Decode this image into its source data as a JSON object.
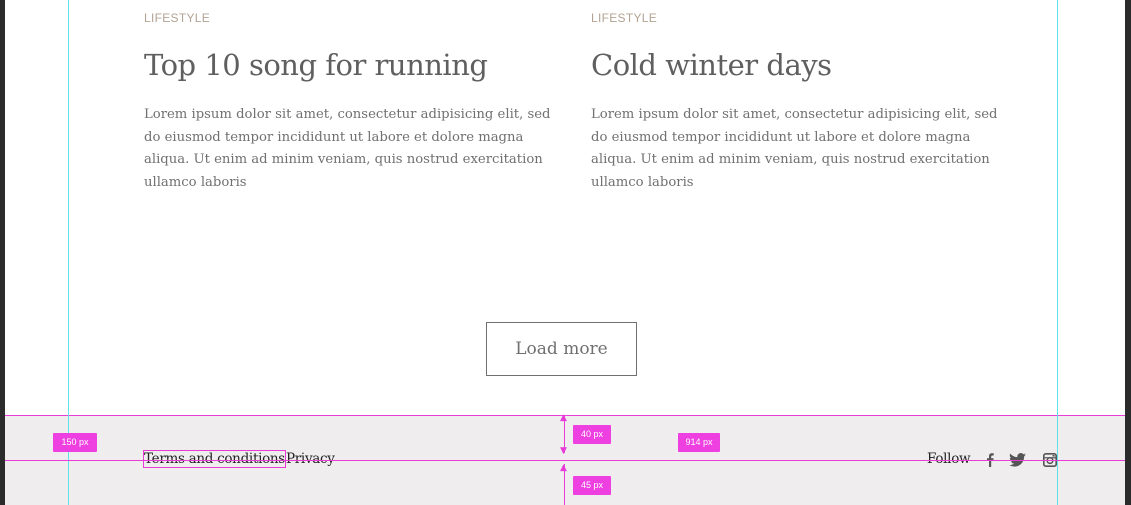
{
  "articles": [
    {
      "category": "LIFESTYLE",
      "title": "Top 10 song for running",
      "excerpt": "Lorem ipsum dolor sit amet, consectetur adipisicing elit, sed do eiusmod tempor incididunt ut labore et dolore magna aliqua. Ut enim ad minim veniam, quis nostrud exercitation ullamco laboris"
    },
    {
      "category": "LIFESTYLE",
      "title": "Cold winter days",
      "excerpt": "Lorem ipsum dolor sit amet, consectetur adipisicing elit, sed do eiusmod tempor incididunt ut labore et dolore magna aliqua. Ut enim ad minim veniam, quis nostrud exercitation ullamco laboris"
    }
  ],
  "load_more_label": "Load more",
  "footer": {
    "terms_label": "Terms and conditions",
    "privacy_label": "Privacy",
    "follow_label": "Follow",
    "social_icons": [
      "facebook-icon",
      "twitter-icon",
      "instagram-icon"
    ]
  },
  "measurements": {
    "left_margin": "150 px",
    "top_padding": "40 px",
    "content_gap": "914 px",
    "bottom_padding": "45 px"
  },
  "colors": {
    "category": "#b3a393",
    "footer_bg": "#efeded",
    "guide": "#5fe3ea",
    "measure": "#e83bd8"
  }
}
